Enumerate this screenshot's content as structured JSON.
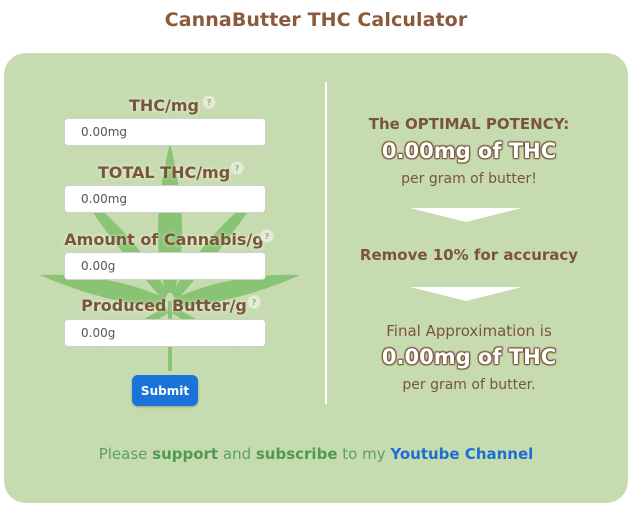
{
  "page": {
    "title": "CannaButter THC Calculator"
  },
  "form": {
    "fields": [
      {
        "label": "THC/mg",
        "help": "?",
        "placeholder": "0.00mg"
      },
      {
        "label": "TOTAL THC/mg",
        "help": "?",
        "placeholder": "0.00mg"
      },
      {
        "label": "Amount of Cannabis/g",
        "help": "?",
        "placeholder": "0.00g"
      },
      {
        "label": "Produced Butter/g",
        "help": "?",
        "placeholder": "0.00g"
      }
    ],
    "submit_label": "Submit"
  },
  "results": {
    "optimal_heading": "The OPTIMAL POTENCY:",
    "optimal_value": "0.00mg of THC",
    "optimal_unit": "per gram of butter!",
    "accuracy_note": "Remove 10% for accuracy",
    "final_heading": "Final Approximation is",
    "final_value": "0.00mg of THC",
    "final_unit": "per gram of butter."
  },
  "footer": {
    "text_1": "Please ",
    "support": "support",
    "text_2": " and ",
    "subscribe": "subscribe",
    "text_3": " to my ",
    "channel_link": "Youtube Channel"
  },
  "colors": {
    "card_background": "#c7dbb1",
    "title": "#8b5a3c",
    "submit_button": "#1a73d9",
    "link": "#1a6fd0",
    "leaf": "#7fbf6a"
  }
}
